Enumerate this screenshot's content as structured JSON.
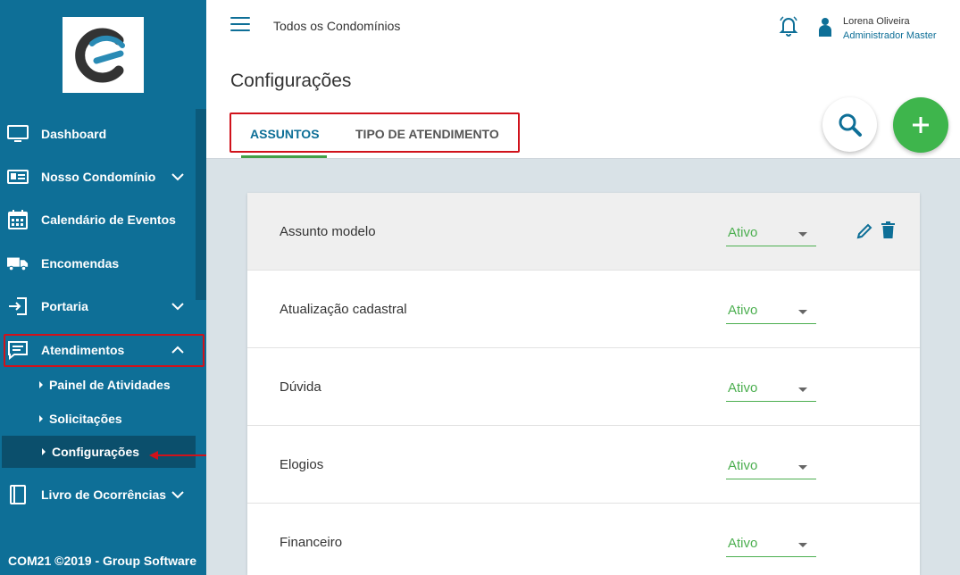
{
  "app": {
    "top_title": "Todos os Condomínios",
    "user": {
      "name": "Lorena Oliveira",
      "role": "Administrador Master"
    }
  },
  "sidebar": {
    "items": [
      {
        "label": "Dashboard",
        "icon": "monitor-icon"
      },
      {
        "label": "Nosso Condomínio",
        "icon": "id-card-icon",
        "expandable": true
      },
      {
        "label": "Calendário de Eventos",
        "icon": "calendar-icon"
      },
      {
        "label": "Encomendas",
        "icon": "truck-icon"
      },
      {
        "label": "Portaria",
        "icon": "login-icon",
        "expandable": true
      },
      {
        "label": "Atendimentos",
        "icon": "chat-icon",
        "expandable": true,
        "expanded": true
      },
      {
        "label": "Livro de Ocorrências",
        "icon": "book-icon",
        "expandable": true
      }
    ],
    "subitems": [
      {
        "label": "Painel de Atividades"
      },
      {
        "label": "Solicitações"
      },
      {
        "label": "Configurações",
        "active": true
      }
    ],
    "footer": "COM21 ©2019 - Group Software"
  },
  "page": {
    "title": "Configurações",
    "tabs": [
      {
        "label": "ASSUNTOS",
        "active": true
      },
      {
        "label": "TIPO DE ATENDIMENTO",
        "active": false
      }
    ]
  },
  "rows": [
    {
      "label": "Assunto modelo",
      "status": "Ativo"
    },
    {
      "label": "Atualização cadastral",
      "status": "Ativo"
    },
    {
      "label": "Dúvida",
      "status": "Ativo"
    },
    {
      "label": "Elogios",
      "status": "Ativo"
    },
    {
      "label": "Financeiro",
      "status": "Ativo"
    }
  ],
  "colors": {
    "sidebar": "#0e6f97",
    "accent_green": "#3eb54c",
    "annotation_red": "#d0121b"
  }
}
